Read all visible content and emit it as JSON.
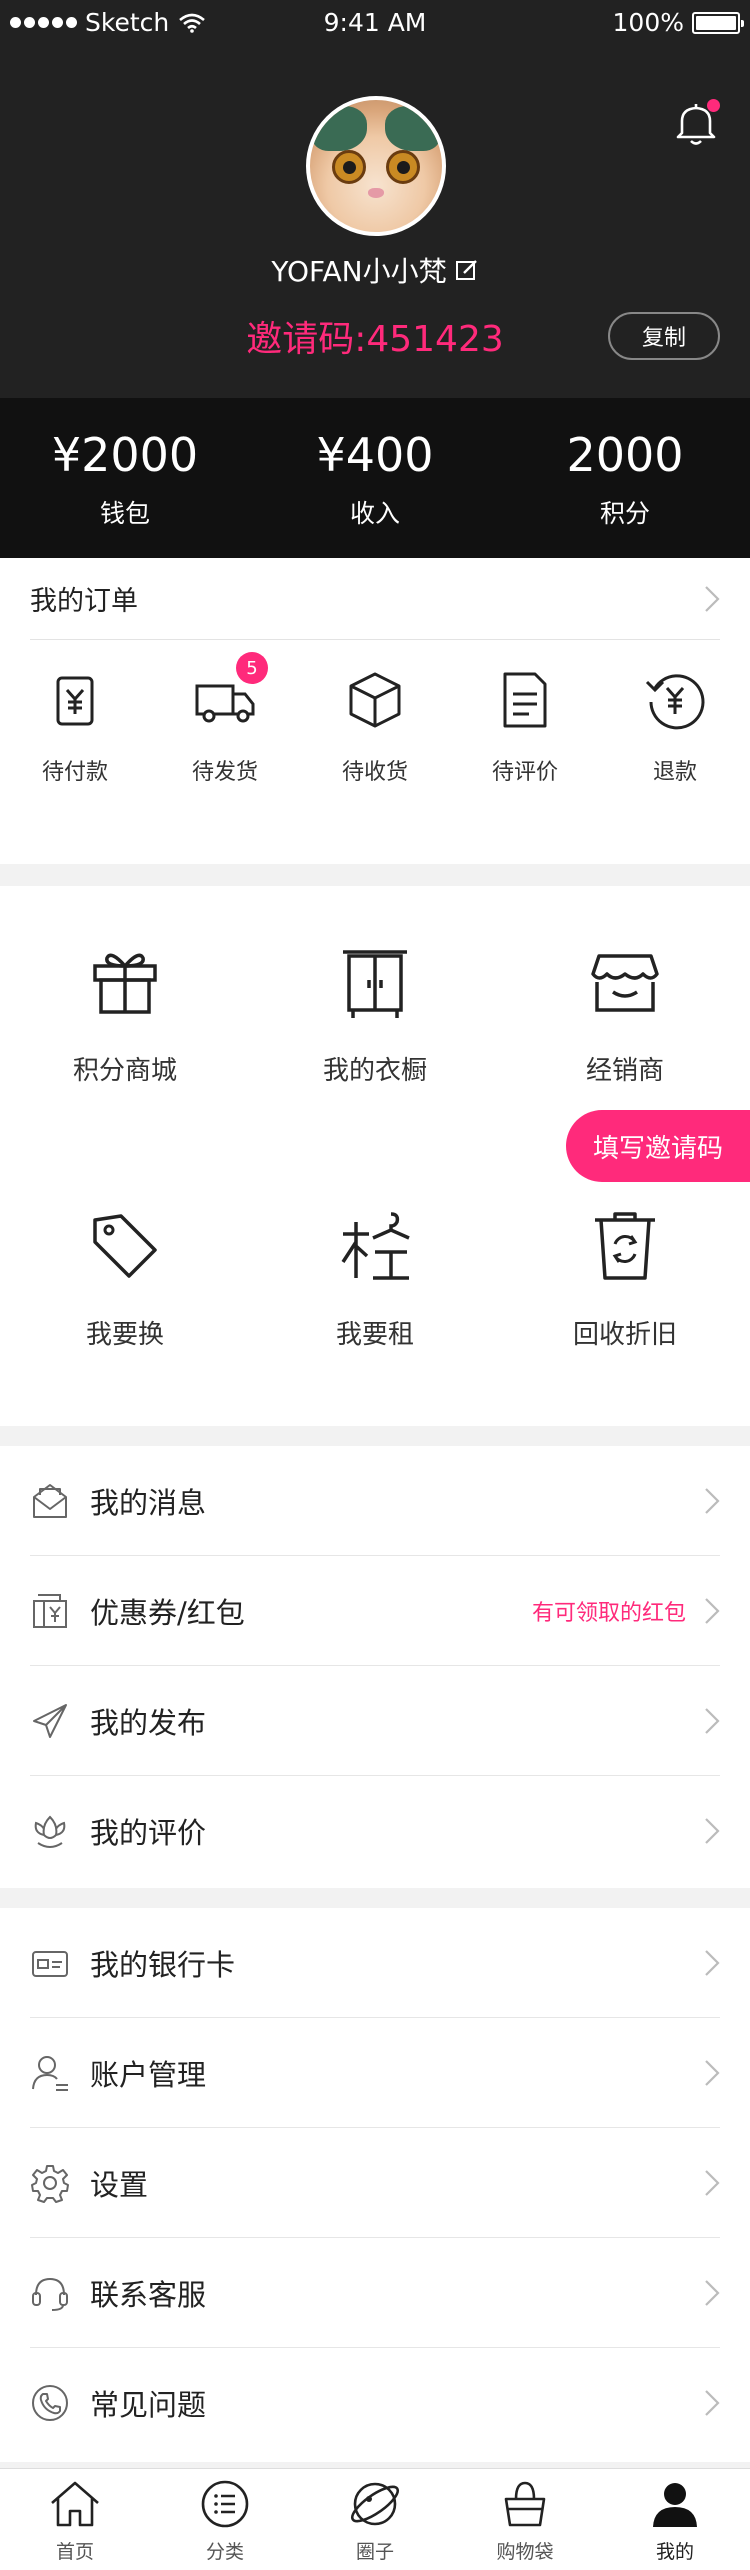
{
  "status_bar": {
    "carrier": "Sketch",
    "time": "9:41 AM",
    "battery": "100%"
  },
  "profile": {
    "username": "YOFAN小小梵",
    "invite_code_text": "邀请码:451423",
    "copy_label": "复制"
  },
  "stats": [
    {
      "value": "¥2000",
      "label": "钱包"
    },
    {
      "value": "¥400",
      "label": "收入"
    },
    {
      "value": "2000",
      "label": "积分"
    }
  ],
  "orders": {
    "title": "我的订单",
    "items": [
      {
        "label": "待付款",
        "icon": "payment-icon"
      },
      {
        "label": "待发货",
        "icon": "truck-icon",
        "badge": "5"
      },
      {
        "label": "待收货",
        "icon": "box-icon"
      },
      {
        "label": "待评价",
        "icon": "document-icon"
      },
      {
        "label": "退款",
        "icon": "refund-icon"
      }
    ]
  },
  "features": [
    {
      "label": "积分商城",
      "icon": "gift-icon"
    },
    {
      "label": "我的衣橱",
      "icon": "wardrobe-icon"
    },
    {
      "label": "经销商",
      "icon": "store-icon"
    },
    {
      "label": "我要换",
      "icon": "tag-icon"
    },
    {
      "label": "我要租",
      "icon": "rent-icon"
    },
    {
      "label": "回收折旧",
      "icon": "recycle-icon"
    }
  ],
  "invite_fill_label": "填写邀请码",
  "list_group_1": [
    {
      "label": "我的消息",
      "icon": "mail-icon"
    },
    {
      "label": "优惠券/红包",
      "icon": "coupon-icon",
      "extra": "有可领取的红包"
    },
    {
      "label": "我的发布",
      "icon": "paper-plane-icon"
    },
    {
      "label": "我的评价",
      "icon": "flower-icon"
    }
  ],
  "list_group_2": [
    {
      "label": "我的银行卡",
      "icon": "bank-card-icon"
    },
    {
      "label": "账户管理",
      "icon": "user-icon"
    },
    {
      "label": "设置",
      "icon": "gear-icon"
    },
    {
      "label": "联系客服",
      "icon": "headset-icon"
    },
    {
      "label": "常见问题",
      "icon": "phone-icon"
    }
  ],
  "tabbar": [
    {
      "label": "首页",
      "icon": "home-icon"
    },
    {
      "label": "分类",
      "icon": "list-icon"
    },
    {
      "label": "圈子",
      "icon": "planet-icon"
    },
    {
      "label": "购物袋",
      "icon": "bag-icon"
    },
    {
      "label": "我的",
      "icon": "profile-icon",
      "active": true
    }
  ],
  "colors": {
    "accent": "#ff2a7b",
    "header_bg": "#222222",
    "stats_bg": "#111111"
  }
}
